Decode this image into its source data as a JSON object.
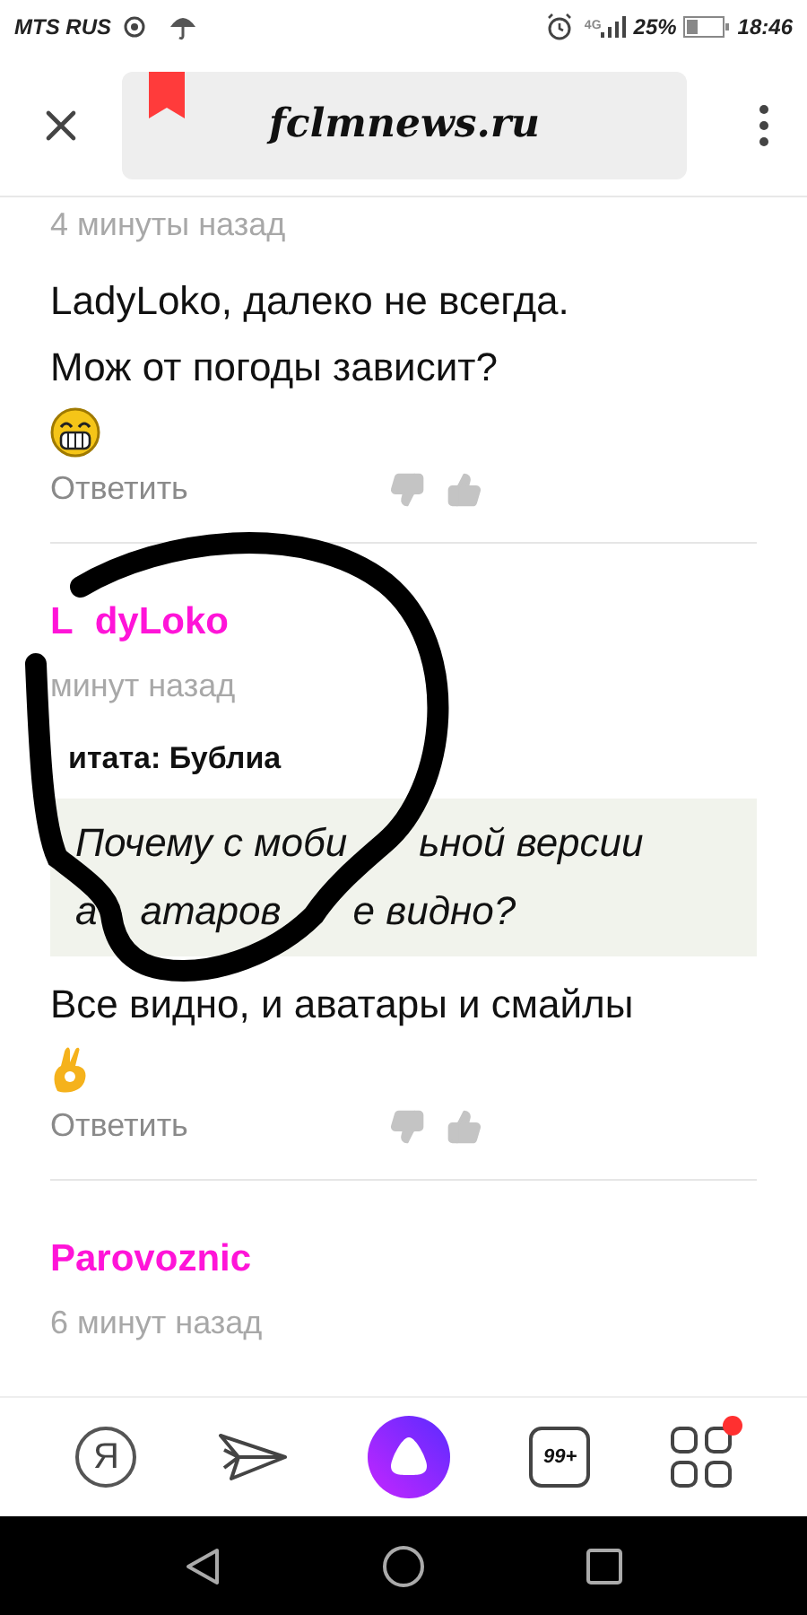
{
  "status_bar": {
    "carrier": "MTS RUS",
    "network": "4G",
    "battery": "25%",
    "time": "18:46"
  },
  "top_bar": {
    "address": "fclmnews.ru"
  },
  "comments": [
    {
      "time_parts": [
        "4 минуты назад"
      ],
      "lines": [
        "LadyLoko, далеко не всегда.",
        "Мож от погоды зависит?"
      ],
      "emoji": {
        "kind": "grin"
      },
      "reply": "Ответить"
    },
    {
      "author_parts": [
        "L",
        "dyLoko"
      ],
      "time_parts": [
        "минут назад"
      ],
      "quote": {
        "label": "итата: Бублиа",
        "lines": [
          [
            "Почему с моби",
            "ьной версии"
          ],
          [
            "а",
            "атаров",
            "е видно?"
          ]
        ]
      },
      "lines": [
        "Все видно, и аватары и смайлы"
      ],
      "emoji": {
        "kind": "ok_hand"
      },
      "reply": "Ответить"
    },
    {
      "author_parts": [
        "Parovoznic"
      ],
      "time_parts": [
        "6 минут назад"
      ]
    }
  ],
  "bottom_nav": {
    "yandex_letter": "Я",
    "tabs_count": "99+",
    "apps_notification": true
  }
}
